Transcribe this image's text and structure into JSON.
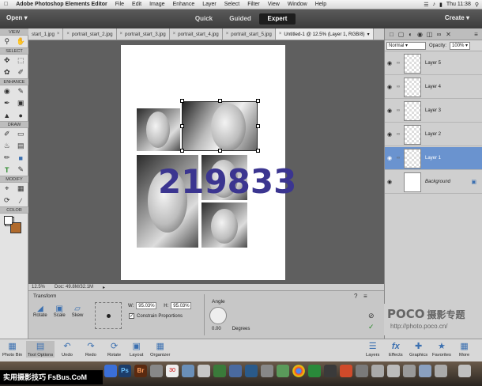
{
  "menubar": {
    "app": "Adobe Photoshop Elements Editor",
    "items": [
      "File",
      "Edit",
      "Image",
      "Enhance",
      "Layer",
      "Select",
      "Filter",
      "View",
      "Window",
      "Help"
    ],
    "clock": "Thu 11:38"
  },
  "modebar": {
    "open": "Open",
    "modes": [
      "Quick",
      "Guided",
      "Expert"
    ],
    "active_mode": "Expert",
    "create": "Create"
  },
  "tabs": [
    "start_1.jpg",
    "portrait_start_2.jpg",
    "portrait_start_3.jpg",
    "portrait_start_4.jpg",
    "portrait_start_5.jpg",
    "Untitled-1 @ 12.5% (Layer 1, RGB/8)"
  ],
  "toolbar": {
    "sections": [
      "VIEW",
      "SELECT",
      "ENHANCE",
      "DRAW",
      "MODIFY",
      "COLOR"
    ]
  },
  "status": {
    "zoom": "12.5%",
    "doc": "Doc: 49.8M/32.1M"
  },
  "options": {
    "title": "Transform",
    "buttons": [
      "Rotate",
      "Scale",
      "Skew"
    ],
    "w_label": "W:",
    "w_value": "95.03%",
    "h_label": "H:",
    "h_value": "95.03%",
    "constrain": "Constrain Proportions",
    "angle_label": "Angle",
    "angle_value": "0.00",
    "degrees": "Degrees"
  },
  "layers": {
    "blend": "Normal",
    "opacity_label": "Opacity:",
    "opacity": "100%",
    "items": [
      "Layer 5",
      "Layer 4",
      "Layer 3",
      "Layer 2",
      "Layer 1",
      "Background"
    ],
    "active": "Layer 1"
  },
  "bottombar": {
    "left": [
      "Photo Bin",
      "Tool Options",
      "Undo",
      "Redo",
      "Rotate",
      "Layout",
      "Organizer"
    ],
    "right": [
      "Layers",
      "Effects",
      "Graphics",
      "Favorites",
      "More"
    ]
  },
  "watermark": "219833",
  "poco": {
    "brand": "POCO",
    "cn": "摄影专题",
    "url": "http://photo.poco.cn/"
  },
  "footer": "实用摄影技巧 FsBus.CoM"
}
